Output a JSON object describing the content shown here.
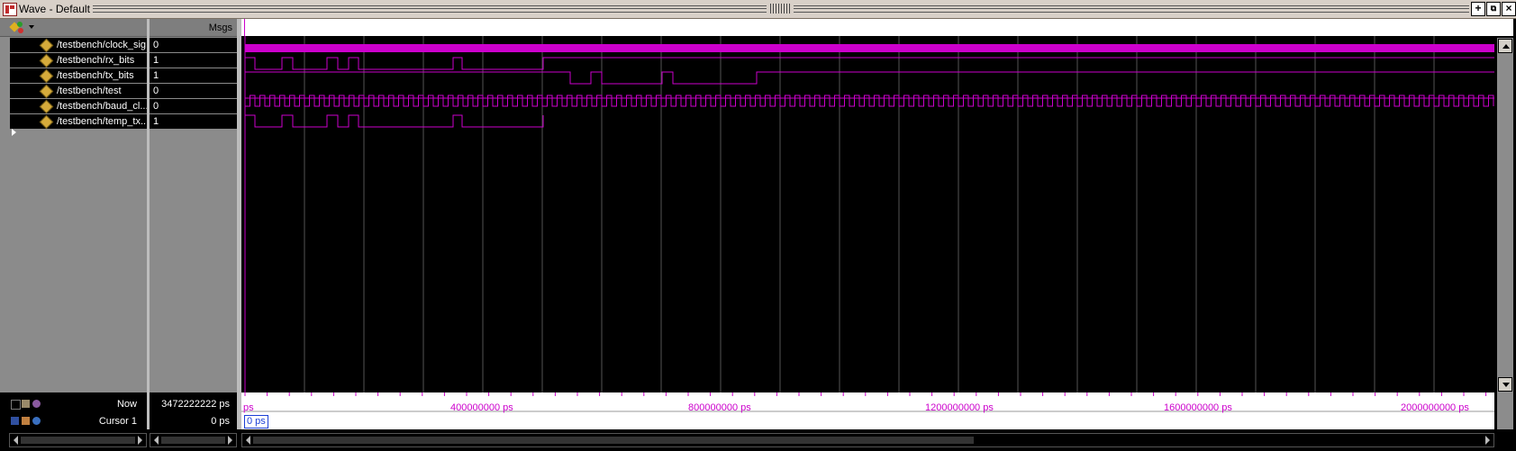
{
  "window": {
    "title": "Wave - Default"
  },
  "panels": {
    "msgs_header": "Msgs"
  },
  "signals": [
    {
      "name": "/testbench/clock_sig",
      "value": "0"
    },
    {
      "name": "/testbench/rx_bits",
      "value": "1"
    },
    {
      "name": "/testbench/tx_bits",
      "value": "1"
    },
    {
      "name": "/testbench/test",
      "value": "0"
    },
    {
      "name": "/testbench/baud_cl...",
      "value": "0"
    },
    {
      "name": "/testbench/temp_tx...",
      "value": "1"
    }
  ],
  "status": {
    "now_label": "Now",
    "now_value": "3472222222 ps",
    "cursor_label": "Cursor 1",
    "cursor_value": "0 ps"
  },
  "timeline": {
    "start_label": "ps",
    "tick_labels": [
      "400000000 ps",
      "800000000 ps",
      "1200000000 ps",
      "1600000000 ps",
      "2000000000 ps"
    ],
    "cursor_box": "0 ps"
  },
  "colors": {
    "wave": "#cc00cc",
    "grid": "#555555",
    "cursor": "#1a3fd6"
  }
}
